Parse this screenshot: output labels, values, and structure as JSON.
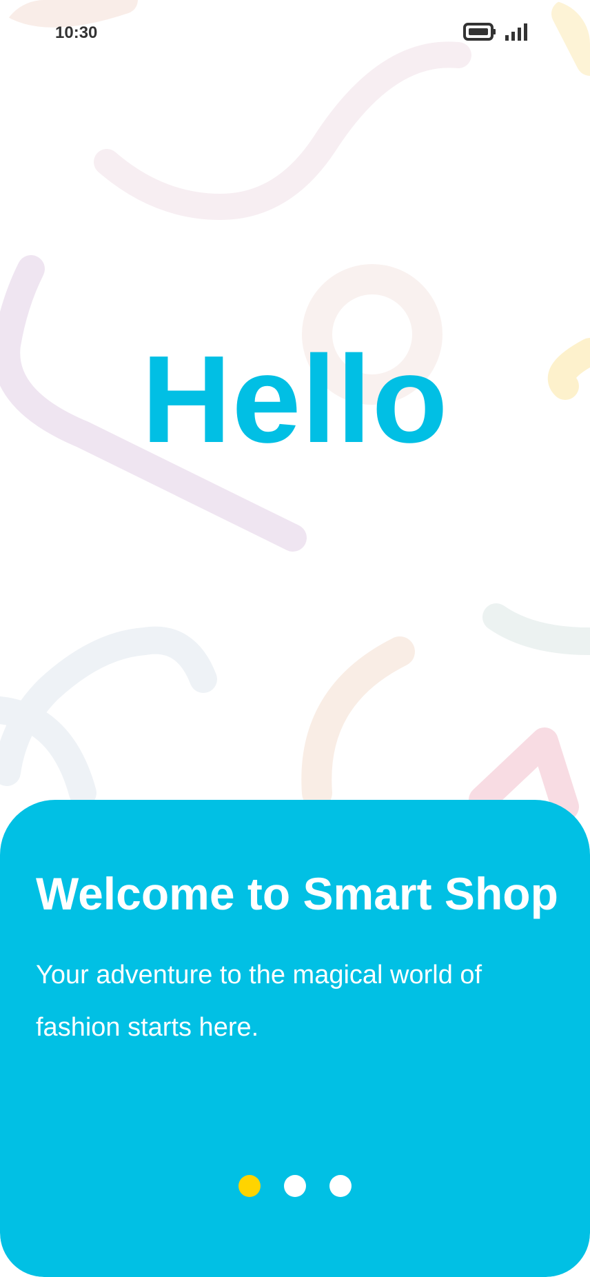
{
  "status_bar": {
    "time": "10:30",
    "icons": [
      "battery-icon",
      "signal-icon"
    ]
  },
  "hero": {
    "greeting": "Hello"
  },
  "panel": {
    "title": "Welcome to Smart Shop",
    "subtitle": "Your adventure to the magical world of fashion starts here."
  },
  "pagination": {
    "total": 3,
    "active_index": 0
  },
  "colors": {
    "accent": "#01c0e4",
    "active_dot": "#ffd400",
    "text_light": "#ffffff",
    "status_text": "#333333"
  }
}
